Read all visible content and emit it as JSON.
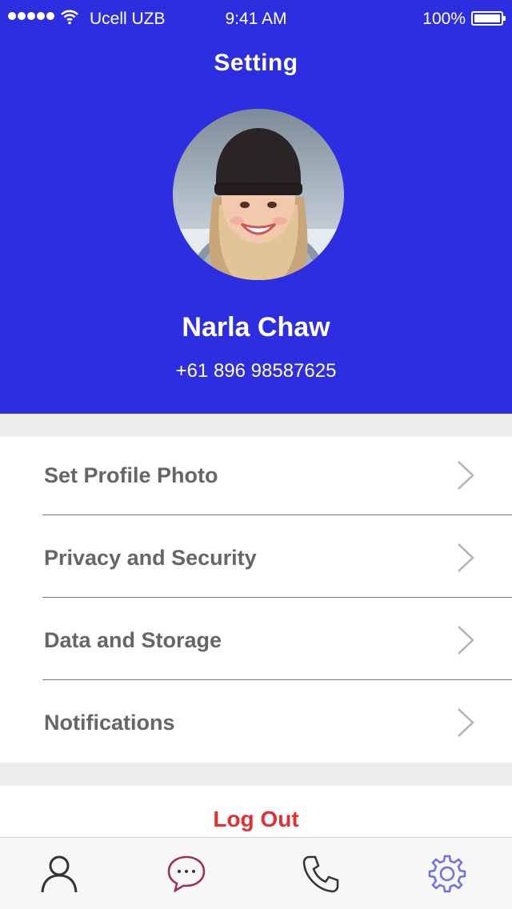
{
  "status_bar": {
    "carrier": "Ucell UZB",
    "time": "9:41 AM",
    "battery": "100%"
  },
  "header": {
    "title": "Setting",
    "background_color": "#2d2ee0"
  },
  "profile": {
    "name": "Narla Chaw",
    "phone": "+61 896 98587625"
  },
  "menu": {
    "items": [
      {
        "label": "Set Profile Photo",
        "icon": "chevron-right-icon"
      },
      {
        "label": "Privacy and Security",
        "icon": "chevron-right-icon"
      },
      {
        "label": "Data and Storage",
        "icon": "chevron-right-icon"
      },
      {
        "label": "Notifications",
        "icon": "chevron-right-icon"
      }
    ]
  },
  "logout": {
    "label": "Log Out",
    "color": "#e0302f"
  },
  "tabbar": {
    "tabs": [
      {
        "icon": "user-icon",
        "active": false
      },
      {
        "icon": "chat-bubble-icon",
        "active": false
      },
      {
        "icon": "phone-icon",
        "active": false
      },
      {
        "icon": "gear-icon",
        "active": true
      }
    ],
    "active_color": "#6f6fe6"
  }
}
